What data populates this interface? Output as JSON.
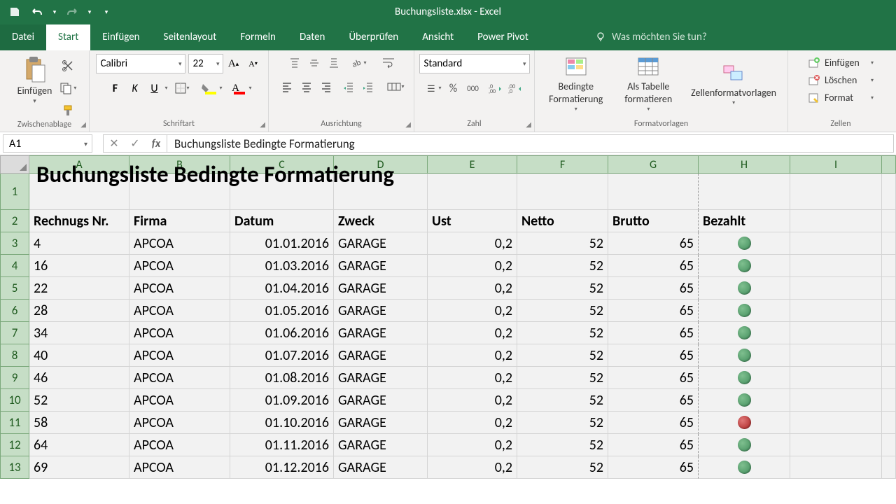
{
  "title": "Buchungsliste.xlsx - Excel",
  "tabs": {
    "file": "Datei",
    "start": "Start",
    "einfuegen": "Einfügen",
    "seitenlayout": "Seitenlayout",
    "formeln": "Formeln",
    "daten": "Daten",
    "ueberpruefen": "Überprüfen",
    "ansicht": "Ansicht",
    "powerpivot": "Power Pivot"
  },
  "tellme": "Was möchten Sie tun?",
  "ribbon": {
    "clipboard": {
      "label": "Zwischenablage",
      "paste": "Einfügen"
    },
    "font": {
      "label": "Schriftart",
      "name": "Calibri",
      "size": "22",
      "bold": "F",
      "italic": "K",
      "underline": "U"
    },
    "alignment": {
      "label": "Ausrichtung"
    },
    "number": {
      "label": "Zahl",
      "format": "Standard"
    },
    "styles": {
      "label": "Formatvorlagen",
      "cond": "Bedingte Formatierung",
      "table": "Als Tabelle formatieren",
      "cellstyles": "Zellenformatvorlagen"
    },
    "cells": {
      "label": "Zellen",
      "insert": "Einfügen",
      "delete": "Löschen",
      "format": "Format"
    }
  },
  "namebox": "A1",
  "formula": "Buchungsliste Bedingte Formatierung",
  "cols": [
    "A",
    "B",
    "C",
    "D",
    "E",
    "F",
    "G",
    "H",
    "I"
  ],
  "rownums": [
    "1",
    "2",
    "3",
    "4",
    "5",
    "6",
    "7",
    "8",
    "9",
    "10",
    "11",
    "12",
    "13"
  ],
  "titlecell": "Buchungsliste Bedingte Formatierung",
  "headers": [
    "Rechnugs Nr.",
    "Firma",
    "Datum",
    "Zweck",
    "Ust",
    "Netto",
    "Brutto",
    "Bezahlt"
  ],
  "rows": [
    {
      "nr": "4",
      "firma": "APCOA",
      "datum": "01.01.2016",
      "zweck": "GARAGE",
      "ust": "0,2",
      "netto": "52",
      "brutto": "65",
      "bez": "green"
    },
    {
      "nr": "16",
      "firma": "APCOA",
      "datum": "01.03.2016",
      "zweck": "GARAGE",
      "ust": "0,2",
      "netto": "52",
      "brutto": "65",
      "bez": "green"
    },
    {
      "nr": "22",
      "firma": "APCOA",
      "datum": "01.04.2016",
      "zweck": "GARAGE",
      "ust": "0,2",
      "netto": "52",
      "brutto": "65",
      "bez": "green"
    },
    {
      "nr": "28",
      "firma": "APCOA",
      "datum": "01.05.2016",
      "zweck": "GARAGE",
      "ust": "0,2",
      "netto": "52",
      "brutto": "65",
      "bez": "green"
    },
    {
      "nr": "34",
      "firma": "APCOA",
      "datum": "01.06.2016",
      "zweck": "GARAGE",
      "ust": "0,2",
      "netto": "52",
      "brutto": "65",
      "bez": "green"
    },
    {
      "nr": "40",
      "firma": "APCOA",
      "datum": "01.07.2016",
      "zweck": "GARAGE",
      "ust": "0,2",
      "netto": "52",
      "brutto": "65",
      "bez": "green"
    },
    {
      "nr": "46",
      "firma": "APCOA",
      "datum": "01.08.2016",
      "zweck": "GARAGE",
      "ust": "0,2",
      "netto": "52",
      "brutto": "65",
      "bez": "green"
    },
    {
      "nr": "52",
      "firma": "APCOA",
      "datum": "01.09.2016",
      "zweck": "GARAGE",
      "ust": "0,2",
      "netto": "52",
      "brutto": "65",
      "bez": "green"
    },
    {
      "nr": "58",
      "firma": "APCOA",
      "datum": "01.10.2016",
      "zweck": "GARAGE",
      "ust": "0,2",
      "netto": "52",
      "brutto": "65",
      "bez": "red"
    },
    {
      "nr": "64",
      "firma": "APCOA",
      "datum": "01.11.2016",
      "zweck": "GARAGE",
      "ust": "0,2",
      "netto": "52",
      "brutto": "65",
      "bez": "green"
    },
    {
      "nr": "69",
      "firma": "APCOA",
      "datum": "01.12.2016",
      "zweck": "GARAGE",
      "ust": "0,2",
      "netto": "52",
      "brutto": "65",
      "bez": "green"
    }
  ]
}
